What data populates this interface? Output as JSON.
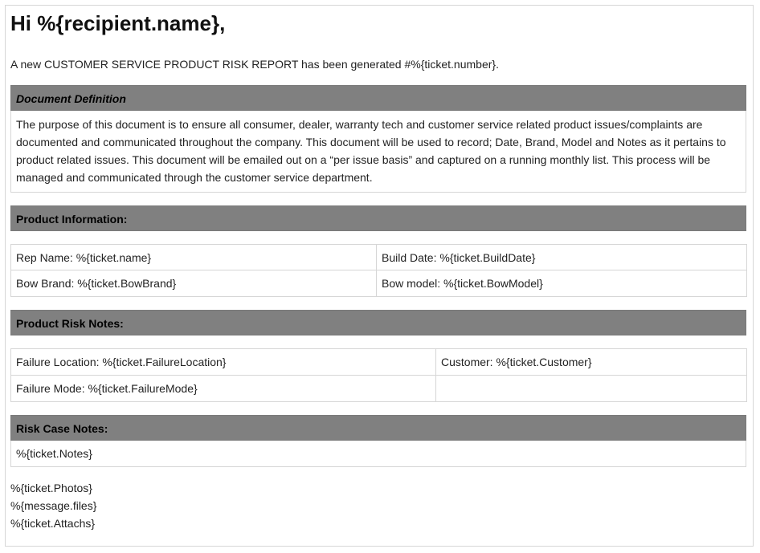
{
  "greeting": "Hi %{recipient.name},",
  "intro": "A new CUSTOMER SERVICE PRODUCT RISK REPORT has been generated #%{ticket.number}.",
  "document_definition": {
    "header": "Document Definition",
    "body": "The purpose of this document is to ensure all consumer, dealer, warranty tech and customer service related product issues/complaints are documented and communicated throughout the company. This document will be used to record; Date, Brand, Model and Notes as it pertains to product related issues. This document will be emailed out on a “per issue basis” and captured on a running monthly list. This process will be managed and communicated through the customer service department."
  },
  "product_information": {
    "header": "Product Information:",
    "rep_name": "Rep Name: %{ticket.name}",
    "build_date": "Build Date: %{ticket.BuildDate}",
    "bow_brand": "Bow Brand: %{ticket.BowBrand}",
    "bow_model": "Bow model: %{ticket.BowModel}"
  },
  "product_risk_notes": {
    "header": "Product Risk Notes:",
    "failure_location": "Failure Location: %{ticket.FailureLocation}",
    "customer": "Customer: %{ticket.Customer}",
    "failure_mode": "Failure Mode: %{ticket.FailureMode}"
  },
  "risk_case_notes": {
    "header": "Risk Case Notes:",
    "notes": "%{ticket.Notes}"
  },
  "footer": {
    "photos": "%{ticket.Photos}",
    "files": "%{message.files}",
    "attachs": "%{ticket.Attachs}"
  }
}
